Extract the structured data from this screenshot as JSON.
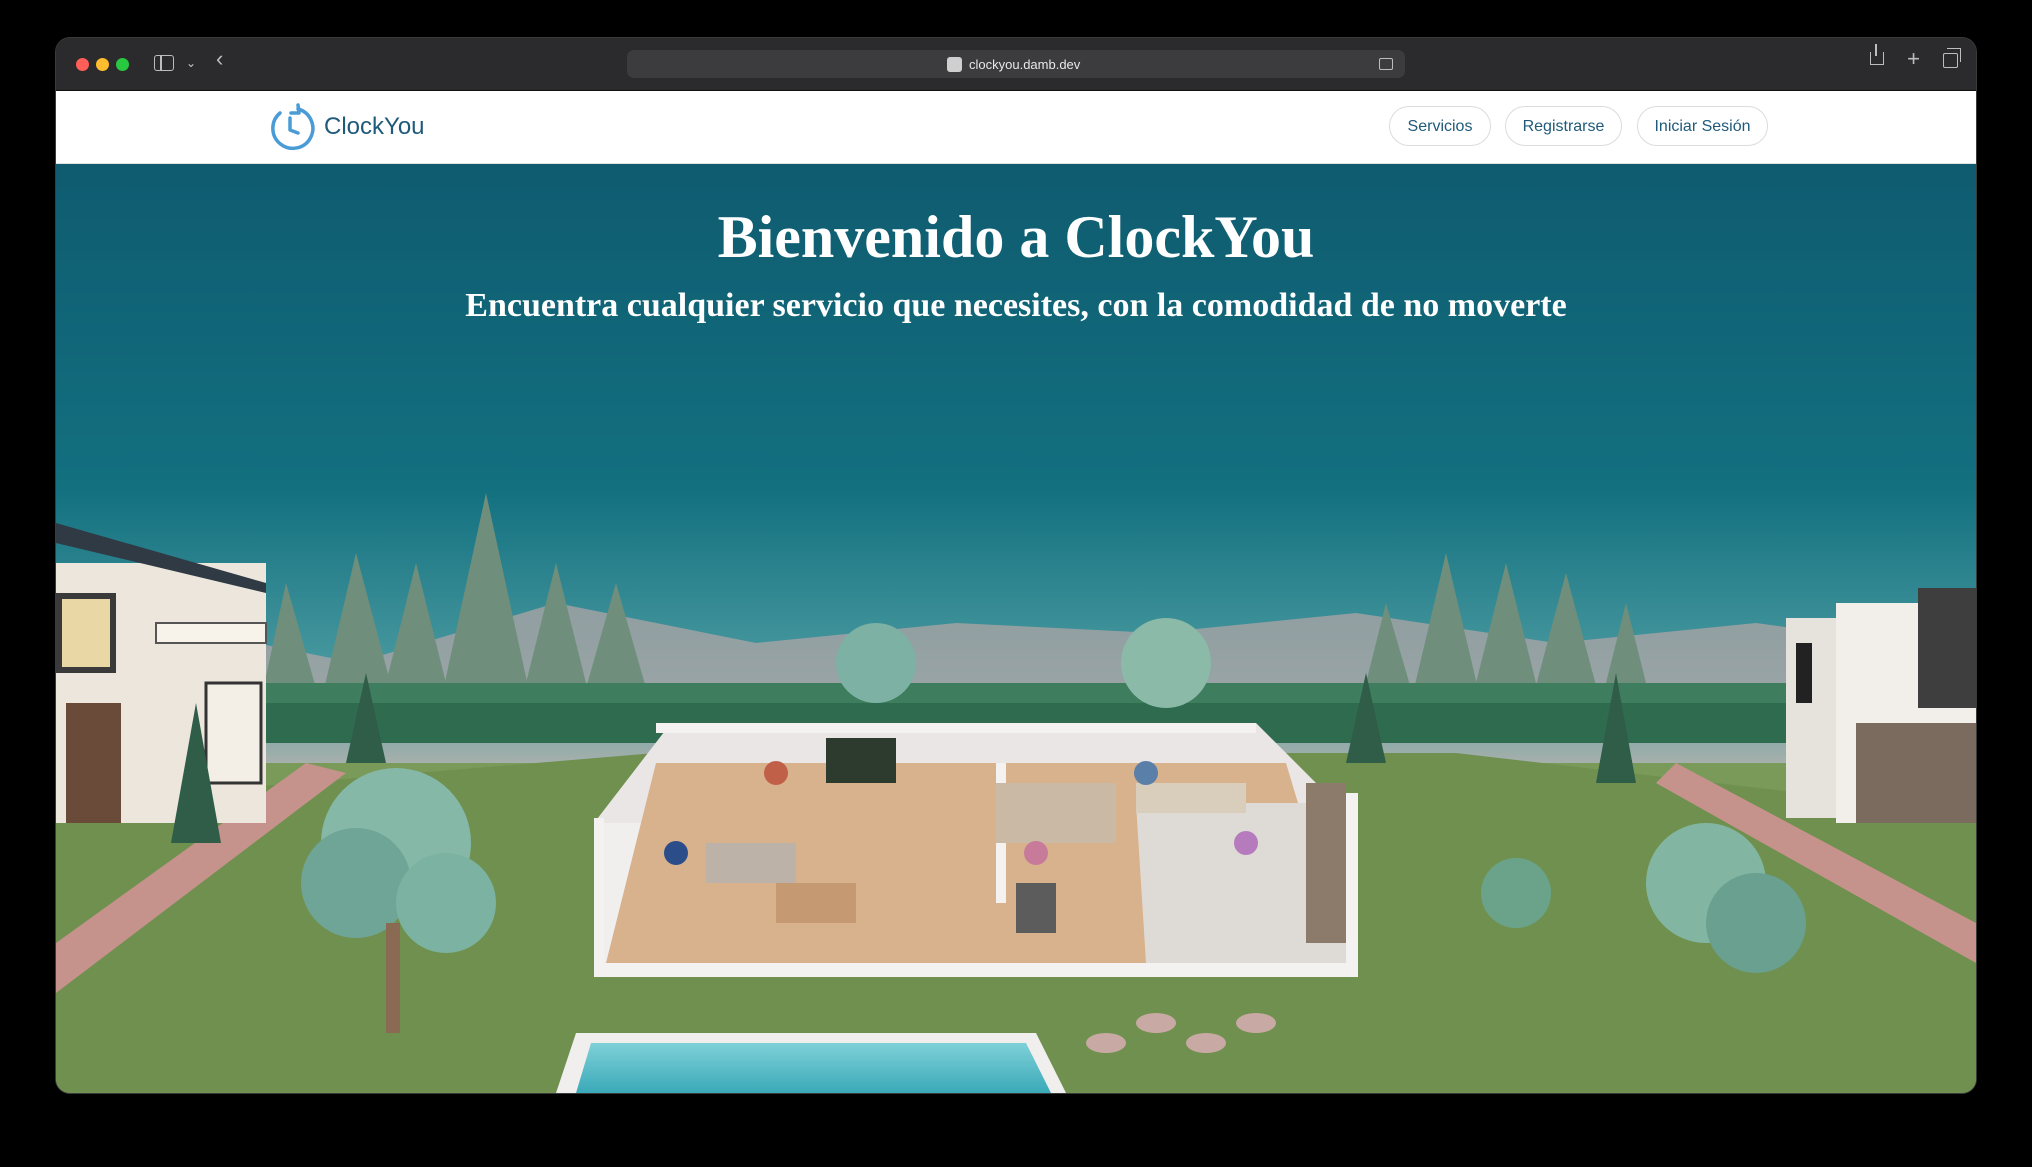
{
  "browser": {
    "url": "clockyou.damb.dev"
  },
  "navbar": {
    "brand": "ClockYou",
    "links": [
      {
        "label": "Servicios"
      },
      {
        "label": "Registrarse"
      },
      {
        "label": "Iniciar Sesión"
      }
    ]
  },
  "hero": {
    "title": "Bienvenido a ClockYou",
    "subtitle": "Encuentra cualquier servicio que necesites, con la comodidad de no moverte"
  },
  "colors": {
    "brand": "#1f5a7a",
    "logo_accent": "#4a9bd6",
    "sky_top": "#0f5b70"
  },
  "icons": [
    "sidebar-icon",
    "chevron-down-icon",
    "back-icon",
    "share-icon",
    "new-tab-icon",
    "tabs-overview-icon",
    "reader-icon",
    "clock-logo-icon"
  ]
}
